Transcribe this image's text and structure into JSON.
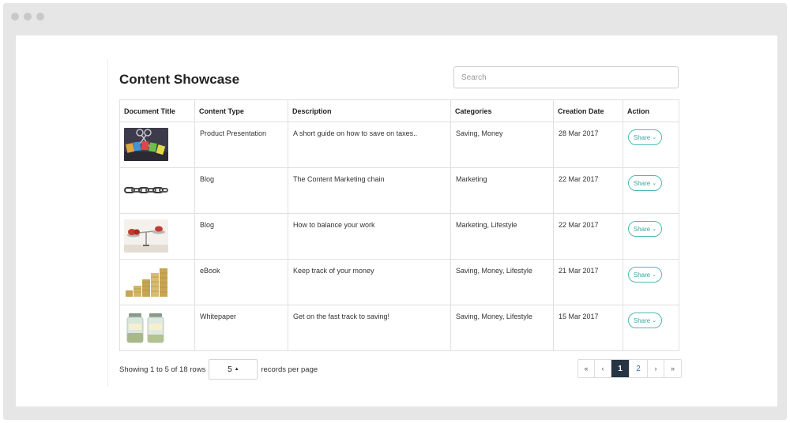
{
  "page": {
    "title": "Content Showcase",
    "search_placeholder": "Search"
  },
  "table": {
    "headers": [
      "Document Title",
      "Content Type",
      "Description",
      "Categories",
      "Creation Date",
      "Action"
    ],
    "rows": [
      {
        "thumb": "taxes-image",
        "content_type": "Product Presentation",
        "description": "A short guide on how to save on taxes..",
        "categories": "Saving, Money",
        "date": "28 Mar 2017",
        "action": "Share"
      },
      {
        "thumb": "chain-image",
        "content_type": "Blog",
        "description": "The Content Marketing chain",
        "categories": "Marketing",
        "date": "22 Mar 2017",
        "action": "Share"
      },
      {
        "thumb": "scale-image",
        "content_type": "Blog",
        "description": "How to balance your work",
        "categories": "Marketing, Lifestyle",
        "date": "22 Mar 2017",
        "action": "Share"
      },
      {
        "thumb": "coins-image",
        "content_type": "eBook",
        "description": "Keep track of your money",
        "categories": "Saving, Money, Lifestyle",
        "date": "21 Mar 2017",
        "action": "Share"
      },
      {
        "thumb": "jars-image",
        "content_type": "Whitepaper",
        "description": "Get on the fast track to saving!",
        "categories": "Saving, Money, Lifestyle",
        "date": "15 Mar 2017",
        "action": "Share"
      }
    ]
  },
  "footer": {
    "showing": "Showing 1 to 5 of 18 rows",
    "page_size": "5",
    "per_page": "records per page"
  },
  "pagination": {
    "first": "«",
    "prev": "‹",
    "pages": [
      "1",
      "2"
    ],
    "next": "›",
    "last": "»"
  },
  "colors": {
    "accent": "#4fb8b4",
    "active_page": "#263444"
  }
}
